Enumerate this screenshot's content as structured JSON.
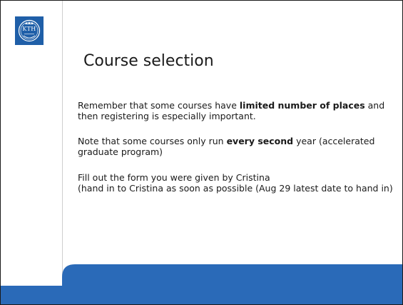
{
  "slide": {
    "logo": {
      "text": "KTH",
      "color": "#1f5fa8",
      "icon": "kth-crest-logo"
    },
    "title": "Course selection",
    "paragraphs": [
      {
        "parts": [
          {
            "text": "Remember that some courses have ",
            "bold": false
          },
          {
            "text": "limited number of places",
            "bold": true
          },
          {
            "text": " and then registering is especially important.",
            "bold": false
          }
        ]
      },
      {
        "parts": [
          {
            "text": "Note that some courses only run ",
            "bold": false
          },
          {
            "text": "every second",
            "bold": true
          },
          {
            "text": " year (accelerated graduate program)",
            "bold": false
          }
        ]
      },
      {
        "lines": [
          "Fill out the form you were given by Cristina",
          "(hand in to Cristina as soon as possible (Aug 29 latest date to hand in)"
        ]
      }
    ],
    "footer_color": "#2a6ab8"
  }
}
